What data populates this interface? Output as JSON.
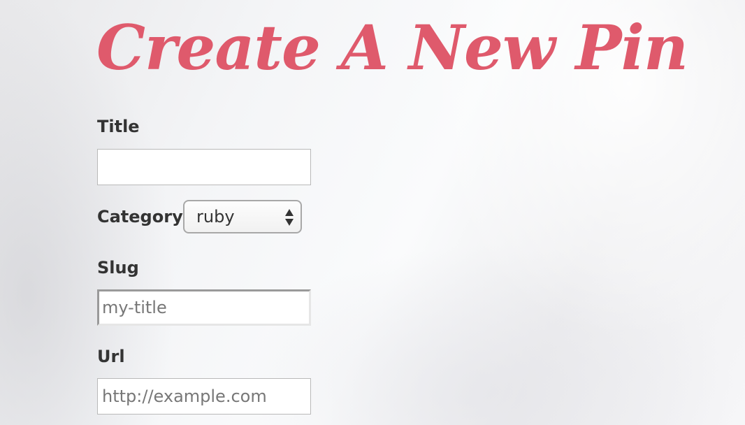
{
  "page": {
    "title": "Create A New Pin"
  },
  "form": {
    "title_label": "Title",
    "title_value": "",
    "category_label": "Category",
    "category_value": "ruby",
    "slug_label": "Slug",
    "slug_placeholder": "my-title",
    "url_label": "Url",
    "url_placeholder": "http://example.com"
  },
  "icons": {
    "select_arrows": "up-down-arrows-icon"
  },
  "colors": {
    "title": "#df5a6c",
    "label": "#333333"
  }
}
